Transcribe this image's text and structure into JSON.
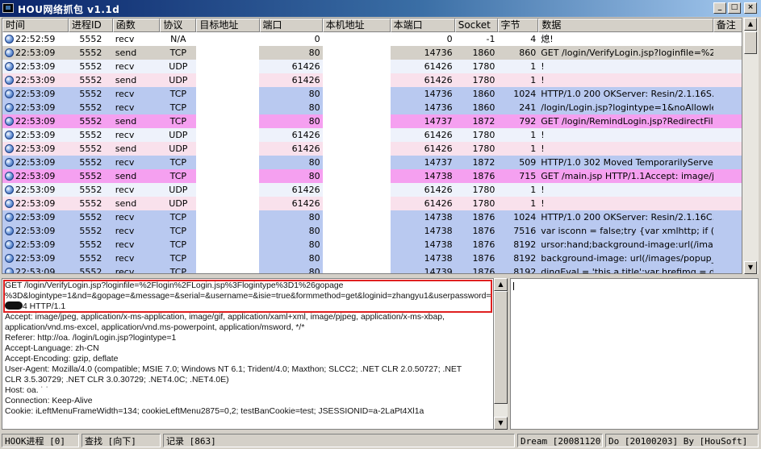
{
  "window": {
    "title": "HOU网络抓包 v1.1d",
    "min_glyph": "_",
    "max_glyph": "□",
    "close_glyph": "×"
  },
  "columns": [
    "时间",
    "进程ID",
    "函数",
    "协议",
    "目标地址",
    "端口",
    "本机地址",
    "本端口",
    "Socket",
    "字节",
    "数据",
    "备注"
  ],
  "rows": [
    {
      "time": "22:52:59",
      "pid": "5552",
      "func": "recv",
      "proto": "N/A",
      "dst": "",
      "port": "0",
      "local": "",
      "lport": "0",
      "socket": "-1",
      "bytes": "4",
      "data": "熄!",
      "note": ""
    },
    {
      "time": "22:53:09",
      "pid": "5552",
      "func": "send",
      "proto": "TCP",
      "dst": "",
      "port": "80",
      "local": "",
      "lport": "14736",
      "socket": "1860",
      "bytes": "860",
      "data": "GET /login/VerifyLogin.jsp?loginfile=%2Fl...",
      "note": ""
    },
    {
      "time": "22:53:09",
      "pid": "5552",
      "func": "recv",
      "proto": "UDP",
      "dst": "",
      "port": "61426",
      "local": "",
      "lport": "61426",
      "socket": "1780",
      "bytes": "1",
      "data": "!",
      "note": ""
    },
    {
      "time": "22:53:09",
      "pid": "5552",
      "func": "send",
      "proto": "UDP",
      "dst": "",
      "port": "61426",
      "local": "",
      "lport": "61426",
      "socket": "1780",
      "bytes": "1",
      "data": "!",
      "note": ""
    },
    {
      "time": "22:53:09",
      "pid": "5552",
      "func": "recv",
      "proto": "TCP",
      "dst": "",
      "port": "80",
      "local": "",
      "lport": "14736",
      "socket": "1860",
      "bytes": "1024",
      "data": "HTTP/1.0 200 OKServer: Resin/2.1.16S...",
      "note": ""
    },
    {
      "time": "22:53:09",
      "pid": "5552",
      "func": "recv",
      "proto": "TCP",
      "dst": "",
      "port": "80",
      "local": "",
      "lport": "14736",
      "socket": "1860",
      "bytes": "241",
      "data": "/login/Login.jsp?logintype=1&noAllowle=y...",
      "note": ""
    },
    {
      "time": "22:53:09",
      "pid": "5552",
      "func": "send",
      "proto": "TCP",
      "dst": "",
      "port": "80",
      "local": "",
      "lport": "14737",
      "socket": "1872",
      "bytes": "792",
      "data": "GET /login/RemindLogin.jsp?RedirectFile...",
      "note": ""
    },
    {
      "time": "22:53:09",
      "pid": "5552",
      "func": "recv",
      "proto": "UDP",
      "dst": "",
      "port": "61426",
      "local": "",
      "lport": "61426",
      "socket": "1780",
      "bytes": "1",
      "data": "!",
      "note": ""
    },
    {
      "time": "22:53:09",
      "pid": "5552",
      "func": "send",
      "proto": "UDP",
      "dst": "",
      "port": "61426",
      "local": "",
      "lport": "61426",
      "socket": "1780",
      "bytes": "1",
      "data": "!",
      "note": ""
    },
    {
      "time": "22:53:09",
      "pid": "5552",
      "func": "recv",
      "proto": "TCP",
      "dst": "",
      "port": "80",
      "local": "",
      "lport": "14737",
      "socket": "1872",
      "bytes": "509",
      "data": "HTTP/1.0 302 Moved TemporarilyServer:...",
      "note": ""
    },
    {
      "time": "22:53:09",
      "pid": "5552",
      "func": "send",
      "proto": "TCP",
      "dst": "",
      "port": "80",
      "local": "",
      "lport": "14738",
      "socket": "1876",
      "bytes": "715",
      "data": "GET /main.jsp HTTP/1.1Accept: image/j...",
      "note": ""
    },
    {
      "time": "22:53:09",
      "pid": "5552",
      "func": "recv",
      "proto": "UDP",
      "dst": "",
      "port": "61426",
      "local": "",
      "lport": "61426",
      "socket": "1780",
      "bytes": "1",
      "data": "!",
      "note": ""
    },
    {
      "time": "22:53:09",
      "pid": "5552",
      "func": "send",
      "proto": "UDP",
      "dst": "",
      "port": "61426",
      "local": "",
      "lport": "61426",
      "socket": "1780",
      "bytes": "1",
      "data": "!",
      "note": ""
    },
    {
      "time": "22:53:09",
      "pid": "5552",
      "func": "recv",
      "proto": "TCP",
      "dst": "",
      "port": "80",
      "local": "",
      "lport": "14738",
      "socket": "1876",
      "bytes": "1024",
      "data": "HTTP/1.0 200 OKServer: Resin/2.1.16C...",
      "note": ""
    },
    {
      "time": "22:53:09",
      "pid": "5552",
      "func": "recv",
      "proto": "TCP",
      "dst": "",
      "port": "80",
      "local": "",
      "lport": "14738",
      "socket": "1876",
      "bytes": "7516",
      "data": "var isconn = false;try {var xmlhttp;   if (win...",
      "note": ""
    },
    {
      "time": "22:53:09",
      "pid": "5552",
      "func": "recv",
      "proto": "TCP",
      "dst": "",
      "port": "80",
      "local": "",
      "lport": "14738",
      "socket": "1876",
      "bytes": "8192",
      "data": "ursor:hand;background-image:url(/images...",
      "note": ""
    },
    {
      "time": "22:53:09",
      "pid": "5552",
      "func": "recv",
      "proto": "TCP",
      "dst": "",
      "port": "80",
      "local": "",
      "lport": "14738",
      "socket": "1876",
      "bytes": "8192",
      "data": "background-image: url(/images/popup_bg...",
      "note": ""
    },
    {
      "time": "22:53:09",
      "pid": "5552",
      "func": "recv",
      "proto": "TCP",
      "dst": "",
      "port": "80",
      "local": "",
      "lport": "14739",
      "socket": "1876",
      "bytes": "8192",
      "data": "dingEval = 'this.a.title';var hrefimg = docu...",
      "note": ""
    }
  ],
  "row_colors": {
    "first": "#ffffff",
    "tcp_recv": "#b9c9f0",
    "tcp_send_gray": "#d4d0c8",
    "tcp_send": "#f5a0f0",
    "udp_recv": "#eef2fb",
    "udp_send": "#f9e1ec",
    "icon_accent": "#1f4fa3"
  },
  "row_style": [
    "first",
    "tcp_send_gray",
    "udp_recv",
    "udp_send",
    "tcp_recv",
    "tcp_recv",
    "tcp_send",
    "udp_recv",
    "udp_send",
    "tcp_recv",
    "tcp_send",
    "udp_recv",
    "udp_send",
    "tcp_recv",
    "tcp_recv",
    "tcp_recv",
    "tcp_recv",
    "tcp_recv"
  ],
  "request_text": {
    "line1": "GET /login/VerifyLogin.jsp?loginfile=%2Flogin%2FLogin.jsp%3Flogintype%3D1%26gopage",
    "line2": "%3D&logintype=1&nd=&gopage=&message=&serial=&username=&isie=true&formmethod=get&loginid=zhangyu1&userpassword=d",
    "line3_suffix": "4 HTTP/1.1",
    "headers": [
      "Accept: image/jpeg, application/x-ms-application, image/gif, application/xaml+xml, image/pjpeg, application/x-ms-xbap,",
      "application/vnd.ms-excel, application/vnd.ms-powerpoint, application/msword, */*",
      "Referer: http://oa.                          /login/Login.jsp?logintype=1",
      "Accept-Language: zh-CN",
      "Accept-Encoding: gzip, deflate",
      "User-Agent: Mozilla/4.0 (compatible; MSIE 7.0; Windows NT 6.1; Trident/4.0; Maxthon; SLCC2; .NET CLR 2.0.50727; .NET",
      "CLR 3.5.30729; .NET CLR 3.0.30729; .NET4.0C; .NET4.0E)",
      "Host: oa.  ˙ ˙",
      "Connection: Keep-Alive",
      "Cookie: iLeftMenuFrameWidth=134; cookieLeftMenu2875=0,2; testBanCookie=test; JSESSIONID=a-2LaPt4Xl1a"
    ]
  },
  "status": {
    "hook": "HOOK进程 [0]",
    "find": "查找 [向下]",
    "records": "记录 [863]",
    "dream": "Dream [20081120]",
    "do": "Do [20100203] By [HouSoft]"
  }
}
